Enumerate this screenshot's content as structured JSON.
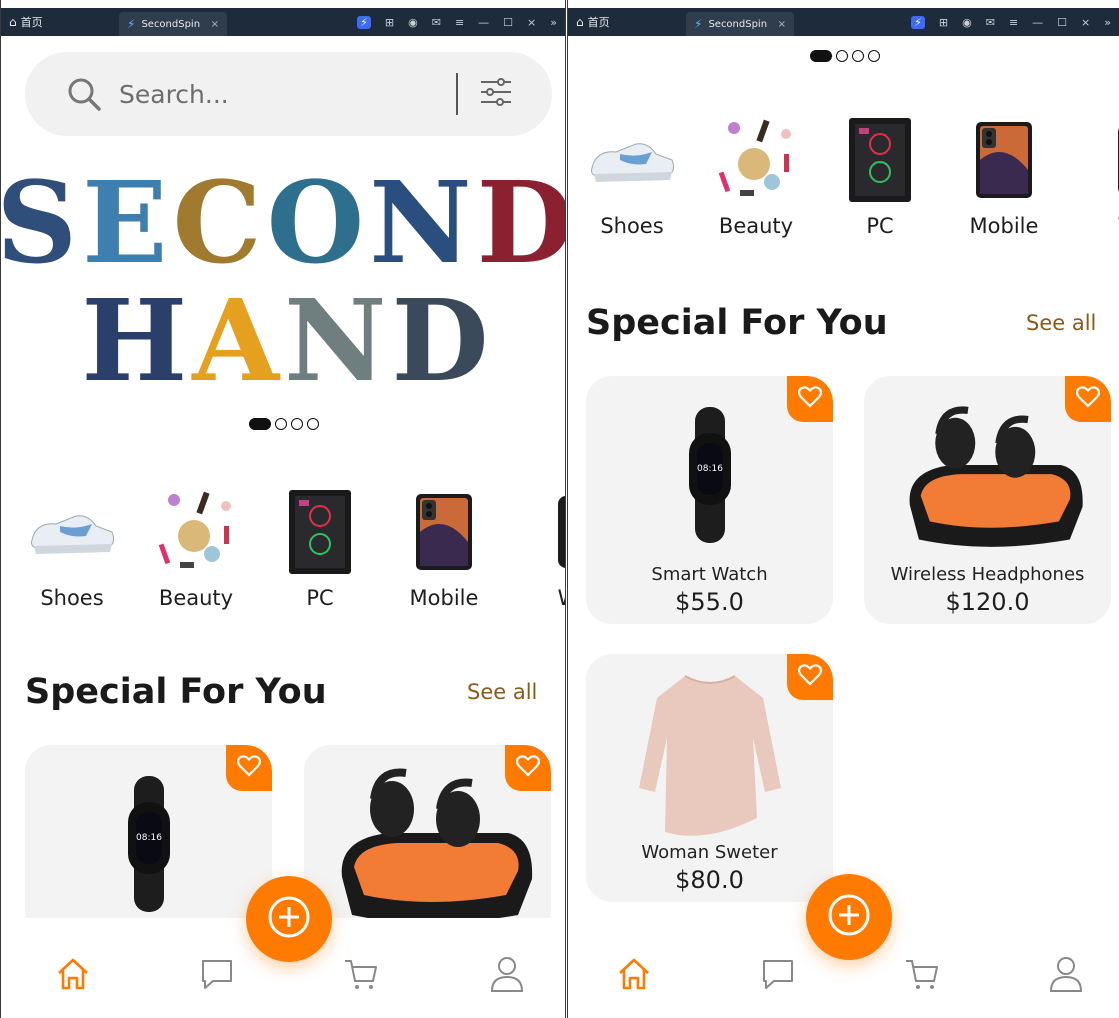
{
  "browser": {
    "home_label": "首页",
    "tab_title": "SecondSpin",
    "tab_close": "×",
    "controls": [
      "—",
      "☐",
      "×",
      "»"
    ]
  },
  "search": {
    "placeholder": "Search..."
  },
  "banner": {
    "line1": "SECOND",
    "line2": "HAND",
    "letter_colors_line1": [
      "#2f4f7a",
      "#3f7fb0",
      "#a07a2e",
      "#2e6f8e",
      "#2a4f7f",
      "#8a2030"
    ],
    "letter_colors_line2": [
      "#2a3f6a",
      "#e5a020",
      "#6f7f80",
      "#3a4a5a"
    ]
  },
  "categories": [
    {
      "label": "Shoes",
      "icon": "sneaker-icon"
    },
    {
      "label": "Beauty",
      "icon": "cosmetics-icon"
    },
    {
      "label": "PC",
      "icon": "pc-tower-icon"
    },
    {
      "label": "Mobile",
      "icon": "smartphone-icon"
    },
    {
      "label": "W",
      "icon": "watch-icon"
    }
  ],
  "section": {
    "title": "Special For You",
    "see_all": "See all"
  },
  "products": [
    {
      "name": "Smart Watch",
      "price": "$55.0"
    },
    {
      "name": "Wireless Headphones",
      "price": "$120.0"
    },
    {
      "name": "Woman Sweter",
      "price": "$80.0"
    }
  ],
  "colors": {
    "accent": "#ff7a00",
    "see_all": "#8a5a1a",
    "card_bg": "#f3f3f3"
  },
  "carousel": {
    "count": 4,
    "active": 0
  }
}
